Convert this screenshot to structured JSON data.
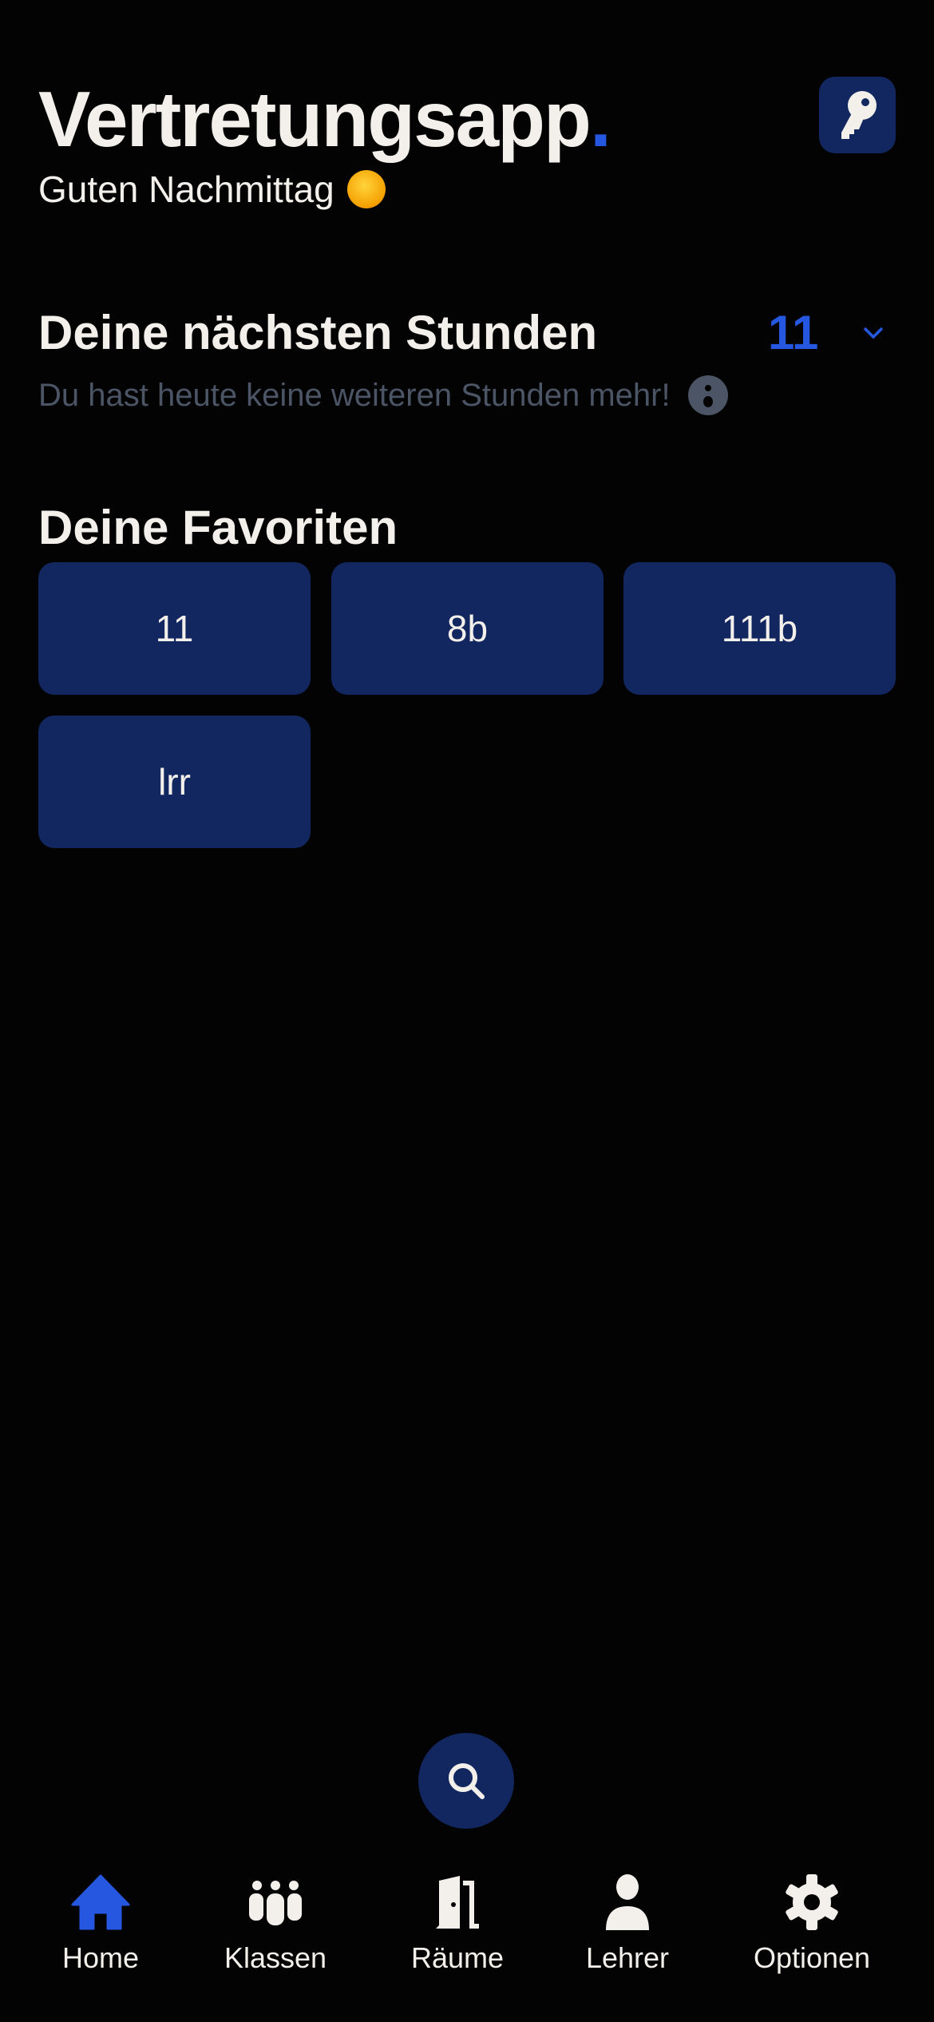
{
  "header": {
    "title": "Vertretungsapp",
    "title_dot": ".",
    "greeting": "Guten Nachmittag",
    "key_icon": "key-icon",
    "greeting_emoji": "sun-emoji"
  },
  "next_lessons": {
    "title": "Deine nächsten Stunden",
    "selected_class": "11",
    "message": "Du hast heute keine weiteren Stunden mehr!",
    "message_emoji": "surprised-face-emoji"
  },
  "favorites": {
    "title": "Deine Favoriten",
    "items": [
      "11",
      "8b",
      "111b",
      "lrr"
    ]
  },
  "search": {
    "icon": "search-icon"
  },
  "nav": {
    "active": "Home",
    "items": [
      {
        "label": "Home",
        "icon": "home-icon"
      },
      {
        "label": "Klassen",
        "icon": "group-icon"
      },
      {
        "label": "Räume",
        "icon": "door-icon"
      },
      {
        "label": "Lehrer",
        "icon": "person-icon"
      },
      {
        "label": "Optionen",
        "icon": "gear-icon"
      }
    ]
  },
  "colors": {
    "accent": "#2557e0",
    "tile": "#12275f",
    "background": "#030303",
    "text": "#f3efeb",
    "muted": "#4b5565"
  }
}
